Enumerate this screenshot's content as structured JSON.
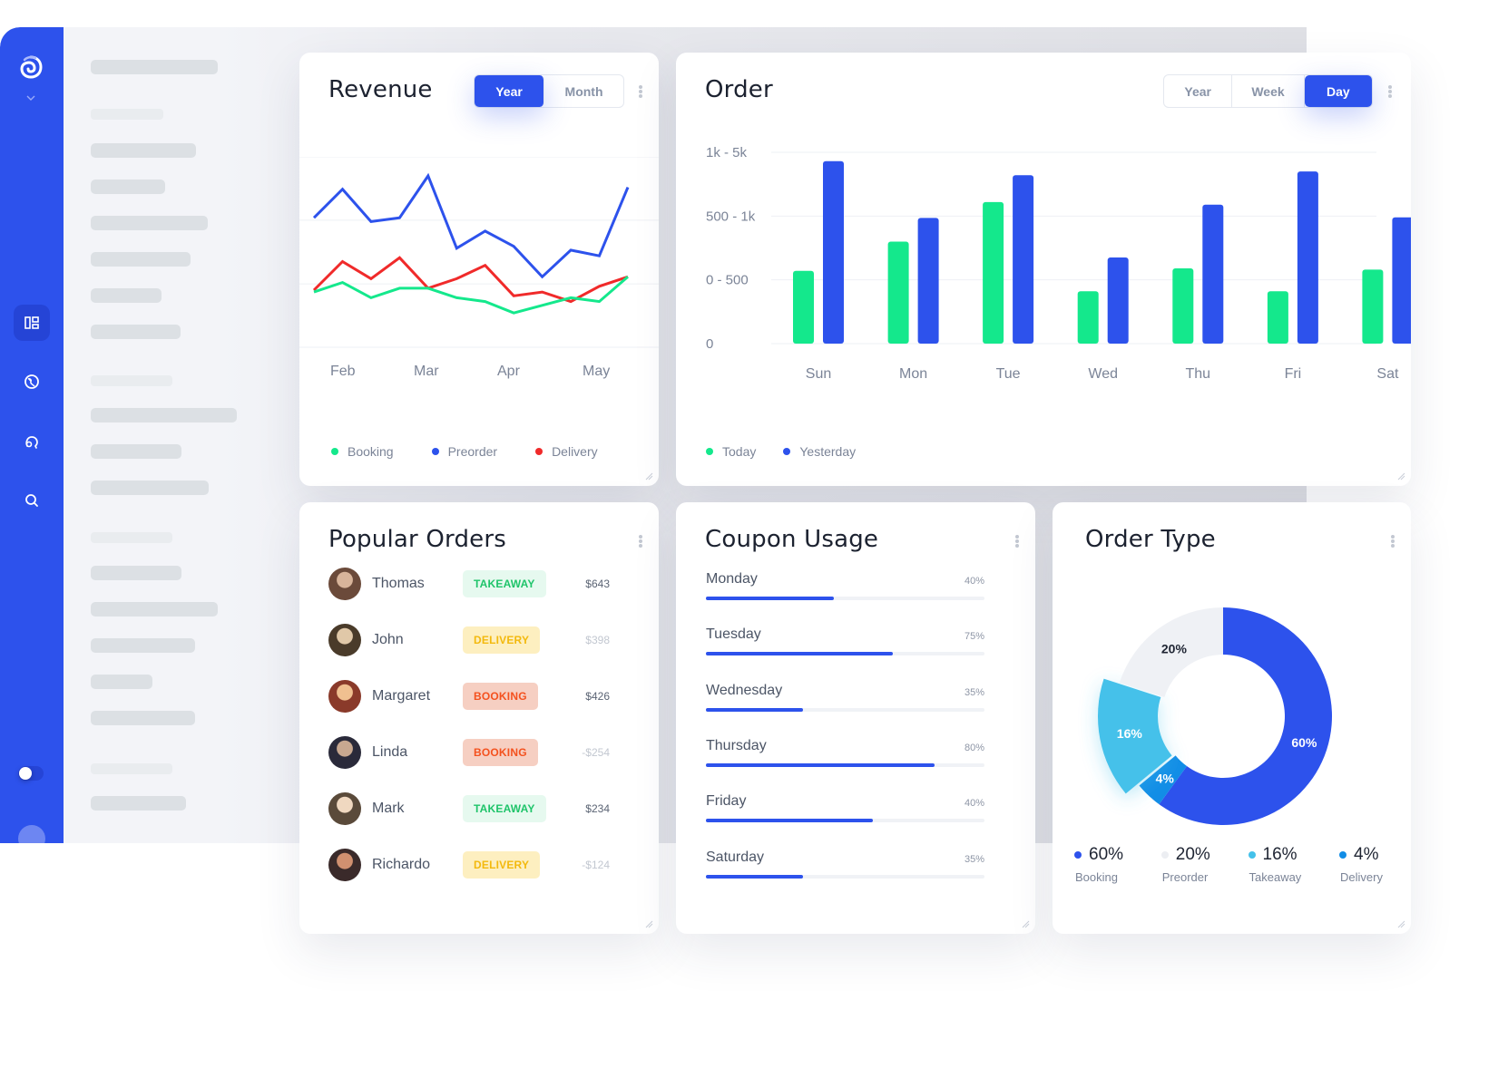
{
  "sidebar": {
    "logo": "spiral-logo-icon",
    "nav_icons": [
      "dashboard-icon",
      "globe-icon",
      "chat-icon",
      "search-icon"
    ],
    "active_nav": "dashboard-icon",
    "toggle_on": false
  },
  "revenue": {
    "title": "Revenue",
    "tabs": [
      {
        "label": "Year",
        "active": true
      },
      {
        "label": "Month",
        "active": false
      }
    ],
    "chart_data": {
      "type": "line",
      "title": "Revenue",
      "x_ticks": [
        "Feb",
        "Mar",
        "Apr",
        "May"
      ],
      "series": [
        {
          "name": "Preorder",
          "color": "#2d52ec",
          "values": [
            68,
            83,
            66,
            68,
            90,
            52,
            61,
            53,
            37,
            51,
            48,
            84
          ]
        },
        {
          "name": "Delivery",
          "color": "#f02a2a",
          "values": [
            30,
            45,
            36,
            47,
            31,
            36,
            43,
            27,
            29,
            24,
            32,
            37
          ]
        },
        {
          "name": "Booking",
          "color": "#14e88c",
          "values": [
            29,
            34,
            26,
            31,
            31,
            26,
            24,
            18,
            22,
            26,
            24,
            37
          ]
        }
      ],
      "ylim": [
        0,
        100
      ],
      "grid": true,
      "legend": [
        {
          "label": "Booking",
          "color": "#14e88c"
        },
        {
          "label": "Preorder",
          "color": "#2d52ec"
        },
        {
          "label": "Delivery",
          "color": "#f02a2a"
        }
      ],
      "legend_position": "bottom"
    }
  },
  "order": {
    "title": "Order",
    "tabs": [
      {
        "label": "Year",
        "active": false
      },
      {
        "label": "Week",
        "active": false
      },
      {
        "label": "Day",
        "active": true
      }
    ],
    "chart_data": {
      "type": "bar",
      "title": "Order",
      "categories": [
        "Sun",
        "Mon",
        "Tue",
        "Wed",
        "Thu",
        "Fri",
        "Sat"
      ],
      "y_ticks": [
        "1k - 5k",
        "500 - 1k",
        "0 - 500",
        "0"
      ],
      "series": [
        {
          "name": "Today",
          "color": "#14e88c",
          "values": [
            1.14,
            1.6,
            2.22,
            0.82,
            1.18,
            0.82,
            1.16
          ]
        },
        {
          "name": "Yesterday",
          "color": "#2d52ec",
          "values": [
            2.86,
            1.97,
            2.64,
            1.35,
            2.18,
            2.7,
            1.98
          ]
        }
      ],
      "ylim": [
        0,
        3
      ],
      "grid": true,
      "legend_position": "bottom"
    }
  },
  "popular_orders": {
    "title": "Popular Orders",
    "rows": [
      {
        "name": "Thomas",
        "type": "TAKEAWAY",
        "amount": "$643",
        "muted": false
      },
      {
        "name": "John",
        "type": "DELIVERY",
        "amount": "$398",
        "muted": true
      },
      {
        "name": "Margaret",
        "type": "BOOKING",
        "amount": "$426",
        "muted": false
      },
      {
        "name": "Linda",
        "type": "BOOKING",
        "amount": "-$254",
        "muted": true
      },
      {
        "name": "Mark",
        "type": "TAKEAWAY",
        "amount": "$234",
        "muted": false
      },
      {
        "name": "Richardo",
        "type": "DELIVERY",
        "amount": "-$124",
        "muted": true
      }
    ],
    "badge_colors": {
      "TAKEAWAY": {
        "bg": "#e6f9ef",
        "fg": "#1fc46a"
      },
      "DELIVERY": {
        "bg": "#fdefc0",
        "fg": "#f3b90d"
      },
      "BOOKING": {
        "bg": "#f6cfc2",
        "fg": "#f4511e"
      }
    }
  },
  "coupon_usage": {
    "title": "Coupon Usage",
    "rows": [
      {
        "day": "Monday",
        "pct_label": "40%",
        "fill": 0.46
      },
      {
        "day": "Tuesday",
        "pct_label": "75%",
        "fill": 0.67
      },
      {
        "day": "Wednesday",
        "pct_label": "35%",
        "fill": 0.35
      },
      {
        "day": "Thursday",
        "pct_label": "80%",
        "fill": 0.82
      },
      {
        "day": "Friday",
        "pct_label": "40%",
        "fill": 0.6
      },
      {
        "day": "Saturday",
        "pct_label": "35%",
        "fill": 0.35
      }
    ]
  },
  "order_type": {
    "title": "Order Type",
    "chart_data": {
      "type": "pie",
      "title": "Order Type",
      "slices": [
        {
          "label": "Booking",
          "value": 60,
          "value_label": "60%",
          "color": "#2d52ec"
        },
        {
          "label": "Delivery",
          "value": 4,
          "value_label": "4%",
          "color": "#128de6"
        },
        {
          "label": "Takeaway",
          "value": 16,
          "value_label": "16%",
          "color": "#44c1ea"
        },
        {
          "label": "Preorder",
          "value": 20,
          "value_label": "20%",
          "color": "#eff1f5"
        }
      ],
      "donut": true
    },
    "legend": [
      {
        "value": "60%",
        "label": "Booking",
        "color": "#2d52ec"
      },
      {
        "value": "20%",
        "label": "Preorder",
        "color": "#eceef2"
      },
      {
        "value": "16%",
        "label": "Takeaway",
        "color": "#44c1ea"
      },
      {
        "value": "4%",
        "label": "Delivery",
        "color": "#128de6"
      }
    ]
  }
}
